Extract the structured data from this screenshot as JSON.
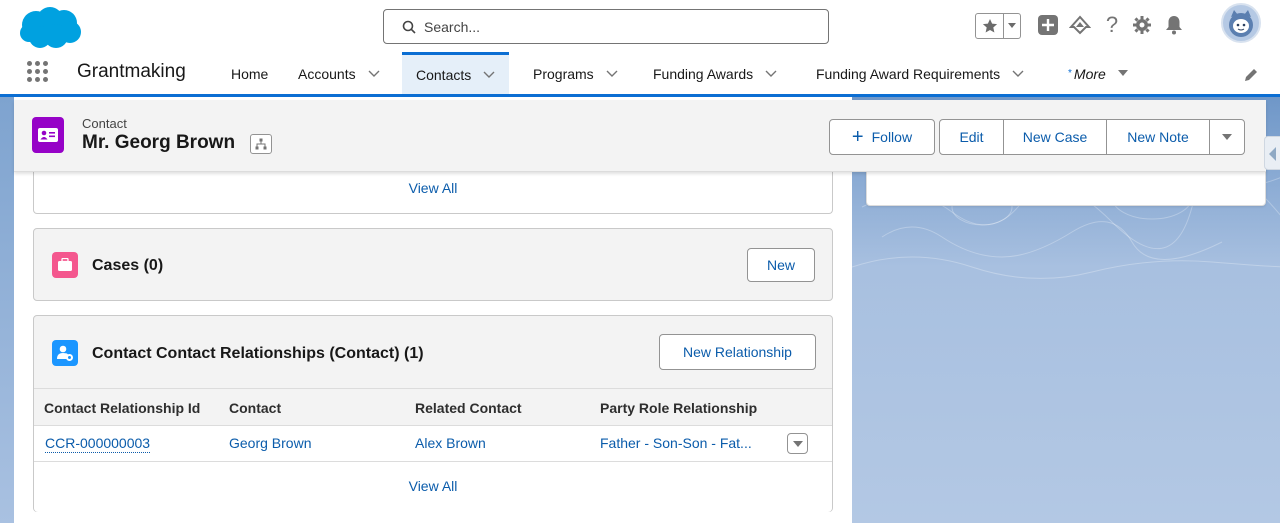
{
  "header": {
    "search_placeholder": "Search...",
    "icons": [
      "favorites-star-icon",
      "favorites-dropdown-icon",
      "global-actions-plus-icon",
      "trailhead-guidance-icon",
      "help-icon",
      "setup-gear-icon",
      "notifications-bell-icon",
      "user-avatar"
    ]
  },
  "nav": {
    "app_name": "Grantmaking",
    "items": [
      {
        "label": "Home",
        "has_menu": false,
        "active": false
      },
      {
        "label": "Accounts",
        "has_menu": true,
        "active": false
      },
      {
        "label": "Contacts",
        "has_menu": true,
        "active": true
      },
      {
        "label": "Programs",
        "has_menu": true,
        "active": false
      },
      {
        "label": "Funding Awards",
        "has_menu": true,
        "active": false
      },
      {
        "label": "Funding Award Requirements",
        "has_menu": true,
        "active": false
      }
    ],
    "more_label": "More",
    "more_marker": "*"
  },
  "record": {
    "type_label": "Contact",
    "name": "Mr. Georg Brown",
    "actions": {
      "follow": "Follow",
      "edit": "Edit",
      "new_case": "New Case",
      "new_note": "New Note"
    }
  },
  "related": {
    "previous_view_all": "View All",
    "cases": {
      "title": "Cases (0)",
      "new_button": "New"
    },
    "contact_relationships": {
      "title": "Contact Contact Relationships (Contact) (1)",
      "new_button": "New Relationship",
      "columns": [
        "Contact Relationship Id",
        "Contact",
        "Related Contact",
        "Party Role Relationship"
      ],
      "rows": [
        {
          "id": "CCR-000000003",
          "contact": "Georg Brown",
          "related_contact": "Alex Brown",
          "party_role_relationship": "Father - Son-Son - Fat..."
        }
      ],
      "view_all": "View All"
    }
  },
  "colors": {
    "brand_blue": "#0b6ed3",
    "link_blue": "#0b5cab",
    "contact_icon": "#9602c7",
    "cases_icon": "#f4578e",
    "relationship_icon": "#1b96ff",
    "salesforce_cloud": "#00a1e0"
  }
}
